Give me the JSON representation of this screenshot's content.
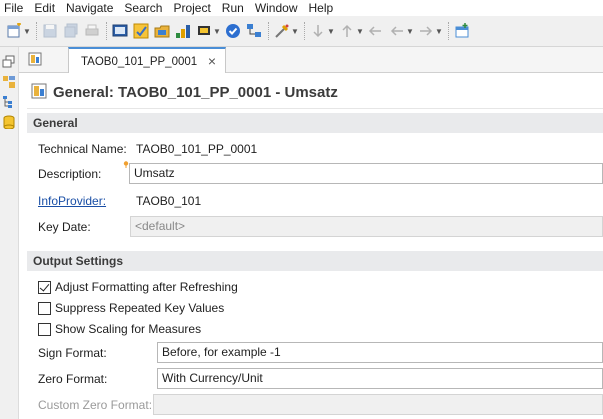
{
  "menu": [
    "File",
    "Edit",
    "Navigate",
    "Search",
    "Project",
    "Run",
    "Window",
    "Help"
  ],
  "toolbar_icons": [
    "new-wizard-icon",
    "save-icon",
    "save-all-icon",
    "print-icon",
    "console-icon",
    "edit-icon",
    "open-project-icon",
    "chart-icon",
    "bookmark-icon",
    "check-icon",
    "tree-icon",
    "search-tool-icon",
    "next-annotation-icon",
    "prev-annotation-icon",
    "last-edit-icon",
    "back-icon",
    "forward-icon",
    "open-perspective-icon"
  ],
  "tab": {
    "label": "TAOB0_101_PP_0001"
  },
  "form": {
    "title": "General: TAOB0_101_PP_0001 - Umsatz"
  },
  "general": {
    "heading": "General",
    "technical_name_label": "Technical Name:",
    "technical_name_value": "TAOB0_101_PP_0001",
    "description_label": "Description:",
    "description_value": "Umsatz",
    "infoprovider_label": "InfoProvider:",
    "infoprovider_value": "TAOB0_101",
    "key_date_label": "Key Date:",
    "key_date_value": "<default>"
  },
  "output": {
    "heading": "Output Settings",
    "adjust_formatting_label": "Adjust Formatting after Refreshing",
    "adjust_formatting_checked": true,
    "suppress_repeated_label": "Suppress Repeated Key Values",
    "suppress_repeated_checked": false,
    "show_scaling_label": "Show Scaling for Measures",
    "show_scaling_checked": false,
    "sign_format_label": "Sign Format:",
    "sign_format_value": "Before, for example -1",
    "zero_format_label": "Zero Format:",
    "zero_format_value": "With Currency/Unit",
    "custom_zero_label": "Custom Zero Format:",
    "custom_zero_value": ""
  },
  "colors": {
    "link": "#1a4fa6",
    "section_bg": "#e9eaec",
    "tab_accent": "#4a8ed6"
  }
}
